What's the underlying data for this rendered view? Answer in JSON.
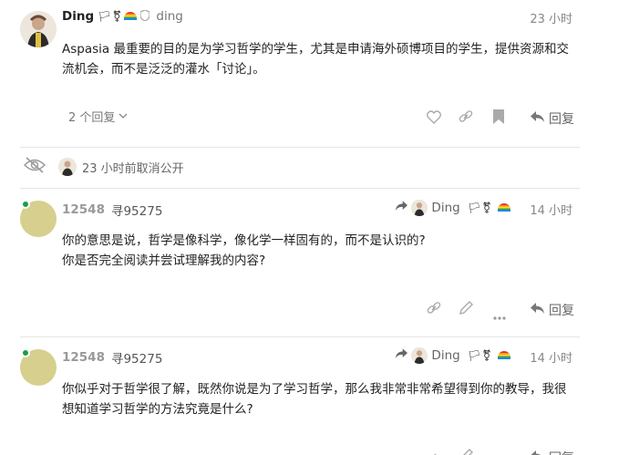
{
  "post1": {
    "username": "Ding",
    "flags": "🏳⚧",
    "handle": "ding",
    "time": "23 小时",
    "body": "Aspasia 最重要的目的是为学习哲学的学生，尤其是申请海外硕博项目的学生，提供资源和交流机会，而不是泛泛的灌水「讨论」。",
    "replies_label": "2 个回复",
    "reply_label": "回复"
  },
  "small_action": {
    "text": "23 小时前取消公开"
  },
  "post2": {
    "username": "12548",
    "handle": "寻95275",
    "reply_to_name": "Ding",
    "reply_to_flags": "🏳⚧",
    "time": "14 小时",
    "body_line1": "你的意思是说，哲学是像科学，像化学一样固有的，而不是认识的?",
    "body_line2": "你是否完全阅读并尝试理解我的内容?",
    "reply_label": "回复"
  },
  "post3": {
    "username": "12548",
    "handle": "寻95275",
    "reply_to_name": "Ding",
    "reply_to_flags": "🏳⚧",
    "time": "14 小时",
    "body": "你似乎对于哲学很了解，既然你说是为了学习哲学，那么我非常非常希望得到你的教导，我很想知道学习哲学的方法究竟是什么?",
    "reply_label": "回复"
  },
  "icons": [
    "heart-icon",
    "link-icon",
    "bookmark-icon",
    "reply-icon",
    "pencil-icon",
    "more-icon",
    "eye-off-icon",
    "shield-icon",
    "chevron-down-icon"
  ]
}
